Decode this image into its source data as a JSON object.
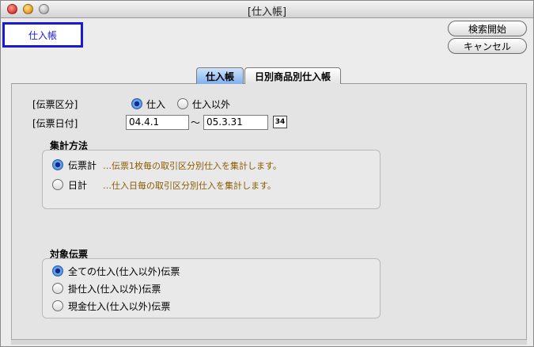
{
  "window": {
    "title": "[仕入帳]"
  },
  "header": {
    "ledger_label": "仕入帳"
  },
  "buttons": {
    "search_start": "検索開始",
    "cancel": "キャンセル"
  },
  "tabs": [
    {
      "label": "仕入帳",
      "selected": true
    },
    {
      "label": "日別商品別仕入帳",
      "selected": false
    }
  ],
  "form": {
    "slip_type_label": "[伝票区分]",
    "slip_type_options": [
      {
        "label": "仕入",
        "selected": true
      },
      {
        "label": "仕入以外",
        "selected": false
      }
    ],
    "slip_date_label": "[伝票日付]",
    "date_from": "04.4.1",
    "date_sep": "～",
    "date_to": "05.3.31",
    "calendar_text": "34"
  },
  "aggregation": {
    "title": "集計方法",
    "options": [
      {
        "label": "伝票計",
        "note": "…伝票1枚毎の取引区分別仕入を集計します。",
        "selected": true
      },
      {
        "label": "日計",
        "note": "…仕入日毎の取引区分別仕入を集計します。",
        "selected": false
      }
    ]
  },
  "target_slips": {
    "title": "対象伝票",
    "options": [
      {
        "label": "全ての仕入(仕入以外)伝票",
        "selected": true
      },
      {
        "label": "掛仕入(仕入以外)伝票",
        "selected": false
      },
      {
        "label": "現金仕入(仕入以外)伝票",
        "selected": false
      }
    ]
  },
  "colors": {
    "accent_blue": "#1a1ad4",
    "note_text": "#8a5a00",
    "tab_selected": "#7fb0ee"
  }
}
